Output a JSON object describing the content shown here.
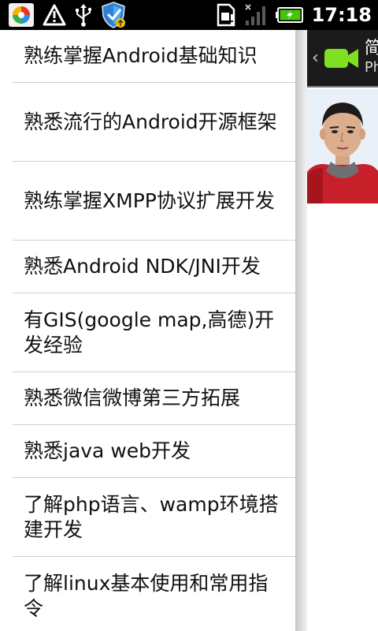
{
  "status_bar": {
    "time": "17:18",
    "colors": {
      "background": "#000000",
      "battery": "#44c40c"
    },
    "left_icons": [
      "app-notification-icon",
      "warning-icon",
      "usb-icon",
      "security-shield-icon"
    ],
    "right_icons": [
      "sim-card-icon",
      "signal-icon",
      "battery-charging-icon"
    ]
  },
  "drawer": {
    "items": [
      {
        "label": "熟练掌握Android基础知识"
      },
      {
        "label": "熟悉流行的Android开源框架"
      },
      {
        "label": "熟练掌握XMPP协议扩展开发"
      },
      {
        "label": "熟悉Android NDK/JNI开发"
      },
      {
        "label": "有GIS(google map,高德)开发经验"
      },
      {
        "label": "熟悉微信微博第三方拓展"
      },
      {
        "label": "熟悉java web开发"
      },
      {
        "label": "了解php语言、wamp环境搭建开发"
      },
      {
        "label": "了解linux基本使用和常用指令"
      }
    ]
  },
  "main_panel": {
    "back_chevron": "‹",
    "app_icon": "video-camera-icon",
    "app_icon_color": "#7ee020",
    "title": "简",
    "subtitle": "Ph"
  }
}
